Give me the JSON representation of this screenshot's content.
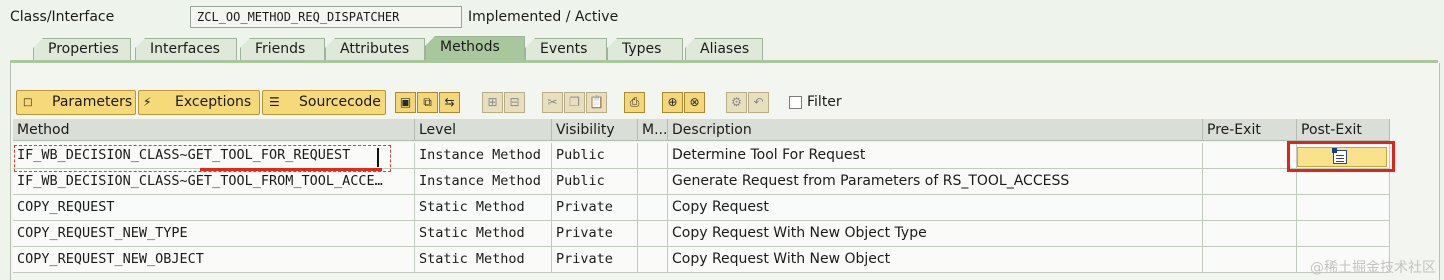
{
  "header": {
    "label": "Class/Interface",
    "class_name": "ZCL_OO_METHOD_REQ_DISPATCHER",
    "status": "Implemented / Active"
  },
  "tabs": [
    {
      "label": "Properties",
      "active": false
    },
    {
      "label": "Interfaces",
      "active": false
    },
    {
      "label": "Friends",
      "active": false
    },
    {
      "label": "Attributes",
      "active": false
    },
    {
      "label": "Methods",
      "active": true
    },
    {
      "label": "Events",
      "active": false
    },
    {
      "label": "Types",
      "active": false
    },
    {
      "label": "Aliases",
      "active": false
    }
  ],
  "toolbar": {
    "parameters_label": "Parameters",
    "exceptions_label": "Exceptions",
    "sourcecode_label": "Sourcecode",
    "filter_label": "Filter",
    "filter_checked": false,
    "button_color": "#f6d978"
  },
  "columns": [
    "Method",
    "Level",
    "Visibility",
    "M...",
    "Description",
    "Pre-Exit",
    "Post-Exit"
  ],
  "rows": [
    {
      "method": "IF_WB_DECISION_CLASS~GET_TOOL_FOR_REQUEST",
      "level": "Instance Method",
      "visibility": "Public",
      "m": "",
      "description": "Determine Tool For Request",
      "pre_exit": "",
      "post_exit": "post-exit-edit-icon"
    },
    {
      "method": "IF_WB_DECISION_CLASS~GET_TOOL_FROM_TOOL_ACCE…",
      "level": "Instance Method",
      "visibility": "Public",
      "m": "",
      "description": "Generate Request from Parameters of RS_TOOL_ACCESS",
      "pre_exit": "",
      "post_exit": ""
    },
    {
      "method": "COPY_REQUEST",
      "level": "Static Method",
      "visibility": "Private",
      "m": "",
      "description": "Copy Request",
      "pre_exit": "",
      "post_exit": ""
    },
    {
      "method": "COPY_REQUEST_NEW_TYPE",
      "level": "Static Method",
      "visibility": "Private",
      "m": "",
      "description": "Copy Request With New Object Type",
      "pre_exit": "",
      "post_exit": ""
    },
    {
      "method": "COPY_REQUEST_NEW_OBJECT",
      "level": "Static Method",
      "visibility": "Private",
      "m": "",
      "description": "Copy Request With New Object",
      "pre_exit": "",
      "post_exit": ""
    }
  ],
  "watermark": "@稀土掘金技术社区",
  "highlight_color": "#e0231b"
}
